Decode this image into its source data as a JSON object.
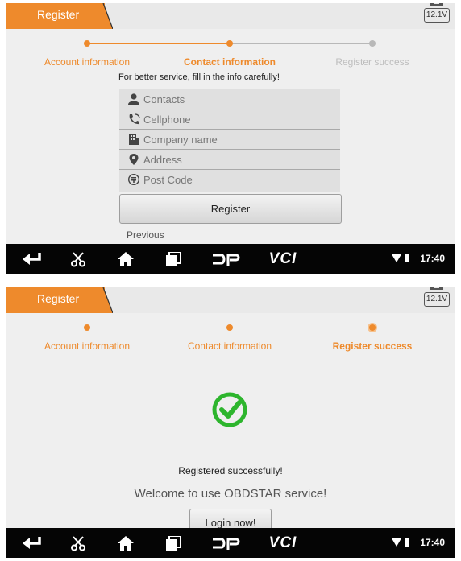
{
  "colors": {
    "accent": "#ee8a2c",
    "inactive": "#b8b8b8",
    "success": "#2db52d"
  },
  "screen1": {
    "tab_label": "Register",
    "battery": "12.1V",
    "steps": [
      "Account information",
      "Contact information",
      "Register success"
    ],
    "hint": "For better service, fill in the info carefully!",
    "fields": [
      {
        "icon": "person-icon",
        "placeholder": "Contacts"
      },
      {
        "icon": "phone-icon",
        "placeholder": "Cellphone"
      },
      {
        "icon": "building-icon",
        "placeholder": "Company name"
      },
      {
        "icon": "location-icon",
        "placeholder": "Address"
      },
      {
        "icon": "postcode-icon",
        "placeholder": "Post Code"
      }
    ],
    "register_button": "Register",
    "previous_label": "Previous"
  },
  "screen2": {
    "tab_label": "Register",
    "battery": "12.1V",
    "steps": [
      "Account information",
      "Contact information",
      "Register success"
    ],
    "success_message": "Registered successfully!",
    "welcome_message": "Welcome to use OBDSTAR service!",
    "login_button": "Login now!"
  },
  "navbar": {
    "icons": [
      "back-icon",
      "scissors-icon",
      "home-icon",
      "recent-apps-icon",
      "dp-icon",
      "vci-icon"
    ],
    "dp_label": "DP",
    "vci_label": "VCI",
    "time": "17:40"
  }
}
